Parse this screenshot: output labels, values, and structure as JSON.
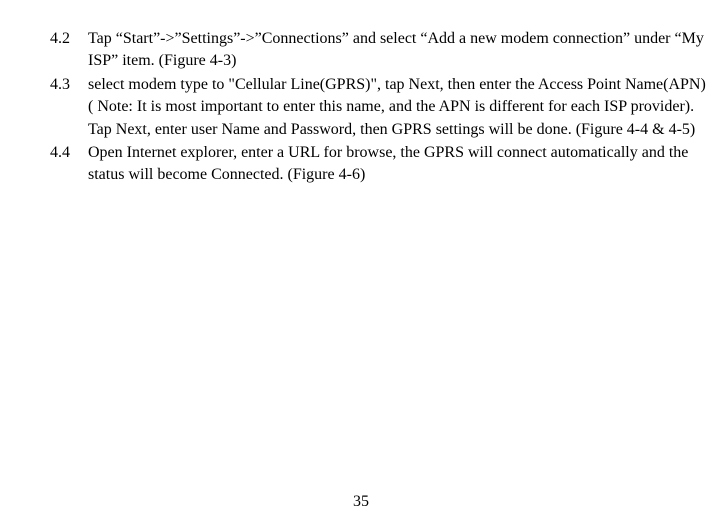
{
  "items": [
    {
      "num": "4.2",
      "text": " Tap “Start”->”Settings”->”Connections” and select “Add a new modem connection” under “My ISP” item. (Figure 4-3)"
    },
    {
      "num": "4.3",
      "text": "select modem type to \"Cellular Line(GPRS)\", tap Next, then enter the Access Point Name(APN) ( Note: It is most important to enter this name, and the APN is different for each ISP provider). Tap   Next, enter user Name and Password, then GPRS settings will be done. (Figure 4-4 & 4-5)"
    },
    {
      "num": "4.4",
      "text": "Open Internet explorer, enter a URL for browse, the GPRS will connect automatically and the status will become Connected. (Figure 4-6)"
    }
  ],
  "page_number": "35"
}
